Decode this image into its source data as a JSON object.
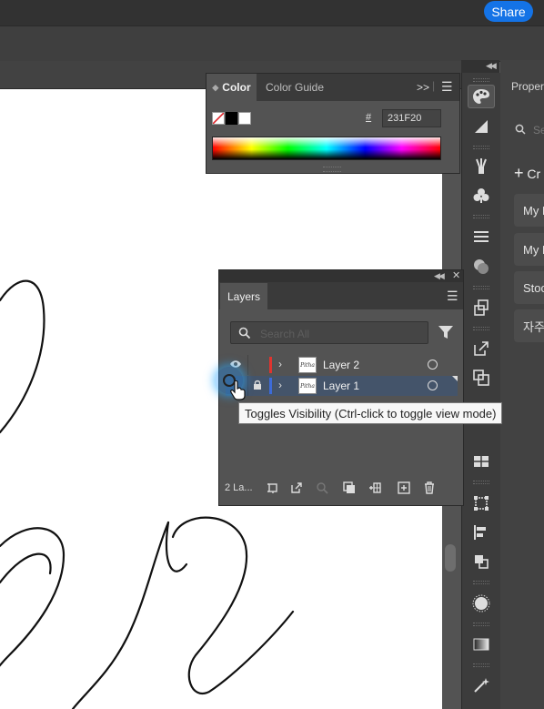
{
  "app": {
    "share_label": "Share"
  },
  "color_panel": {
    "tab_active": "Color",
    "tab_inactive": "Color Guide",
    "expand_symbol": ">>",
    "hex_symbol": "#",
    "hex_value": "231F20"
  },
  "properties_panel": {
    "title": "Proper",
    "search_placeholder": "Se",
    "create_label": "Cr",
    "items": [
      "My L",
      "My L",
      "Stoc",
      "자주"
    ]
  },
  "layers_panel": {
    "tab": "Layers",
    "search_placeholder": "Search All",
    "layers": [
      {
        "name": "Layer 2",
        "color": "#e0342f",
        "visible": true,
        "locked": false,
        "thumb": "Pitha"
      },
      {
        "name": "Layer 1",
        "color": "#3d6bd8",
        "visible": false,
        "locked": true,
        "thumb": "Pitha"
      }
    ],
    "footer_count": "2 La..."
  },
  "tooltip": {
    "text": "Toggles Visibility (Ctrl-click to toggle view mode)"
  },
  "colors": {
    "accent": "#1473e6",
    "panel_bg": "#535353",
    "selected_row": "#44546a"
  }
}
